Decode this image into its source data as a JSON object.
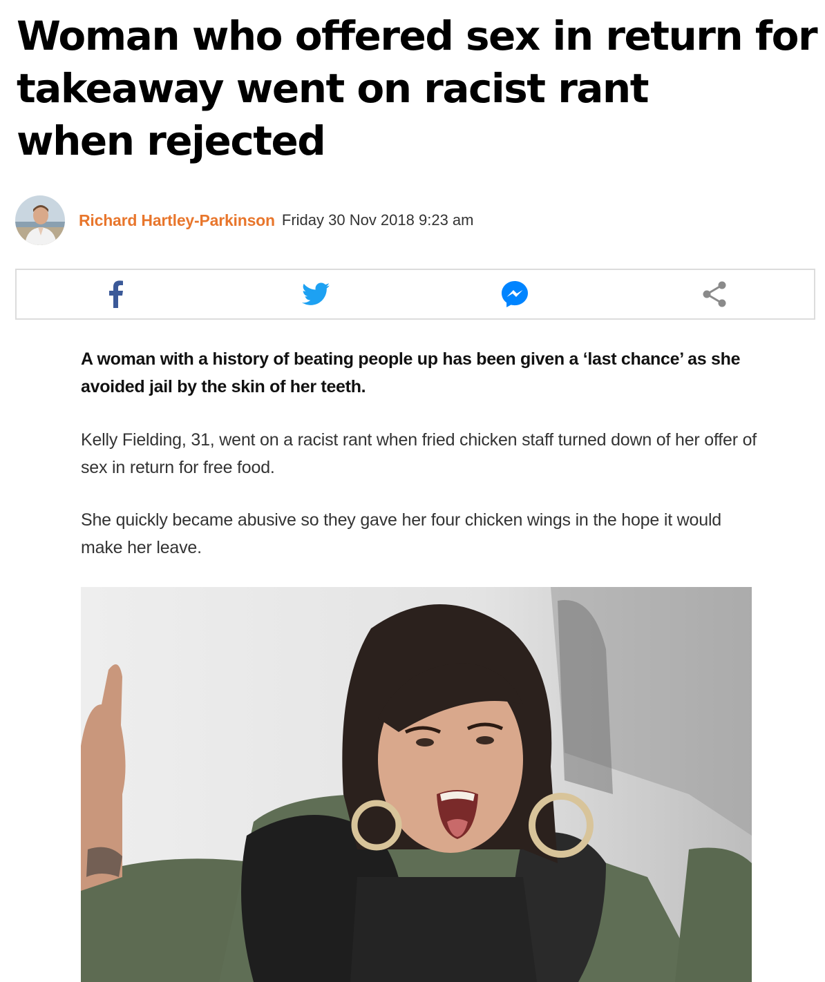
{
  "article": {
    "headline_lines": [
      "Woman who offered sex in return for",
      "takeaway went on racist rant",
      "when rejected"
    ],
    "author": "Richard Hartley-Parkinson",
    "date": "Friday 30 Nov 2018 9:23 am",
    "lead": "A woman with a history of beating people up has been given a ‘last chance’ as she avoided jail by the skin of her teeth.",
    "paragraphs": [
      "Kelly Fielding, 31, went on a racist rant when fried chicken staff turned down of her offer of sex in return for free food.",
      "She quickly became abusive so they gave her four chicken wings in the hope it would make her leave."
    ]
  },
  "share": {
    "icons": [
      "facebook-icon",
      "twitter-icon",
      "messenger-icon",
      "share-icon"
    ]
  },
  "colors": {
    "author": "#e8762c",
    "facebook": "#3b5998",
    "twitter": "#1da1f2",
    "messenger": "#0084ff",
    "share": "#8a8a8a",
    "border": "#dcdcdc"
  }
}
